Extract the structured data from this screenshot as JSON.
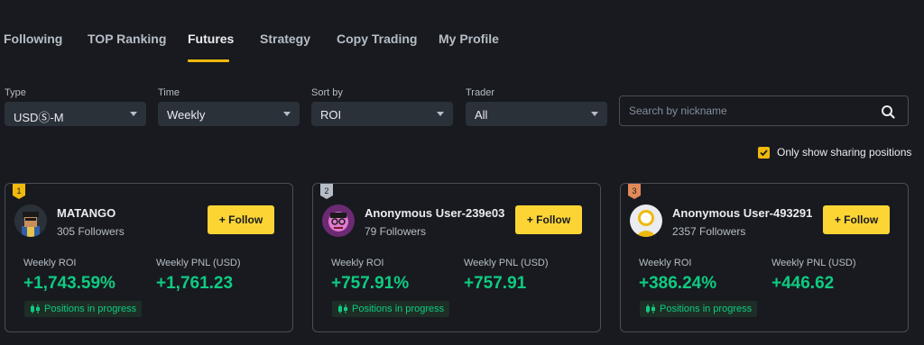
{
  "tabs": [
    {
      "label": "Following"
    },
    {
      "label": "TOP Ranking"
    },
    {
      "label": "Futures"
    },
    {
      "label": "Strategy"
    },
    {
      "label": "Copy Trading"
    },
    {
      "label": "My Profile"
    }
  ],
  "active_tab": "Futures",
  "filters": {
    "type": {
      "label": "Type",
      "value": "USDⓈ-M"
    },
    "time": {
      "label": "Time",
      "value": "Weekly"
    },
    "sort_by": {
      "label": "Sort by",
      "value": "ROI"
    },
    "trader": {
      "label": "Trader",
      "value": "All"
    }
  },
  "search": {
    "placeholder": "Search by nickname"
  },
  "only_sharing": {
    "label": "Only show sharing positions",
    "checked": true
  },
  "colors": {
    "accent": "#fcd535",
    "positive": "#0ecb81",
    "gold": "#f0b90b",
    "silver": "#b7bdc6",
    "bronze": "#e0895a"
  },
  "cards": [
    {
      "rank": "1",
      "name": "MATANGO",
      "followers": "305 Followers",
      "follow_label": "+ Follow",
      "roi_label": "Weekly ROI",
      "roi_value": "+1,743.59%",
      "pnl_label": "Weekly PNL (USD)",
      "pnl_value": "+1,761.23",
      "status": "Positions in progress"
    },
    {
      "rank": "2",
      "name": "Anonymous User-239e03",
      "followers": "79 Followers",
      "follow_label": "+ Follow",
      "roi_label": "Weekly ROI",
      "roi_value": "+757.91%",
      "pnl_label": "Weekly PNL (USD)",
      "pnl_value": "+757.91",
      "status": "Positions in progress"
    },
    {
      "rank": "3",
      "name": "Anonymous User-493291",
      "followers": "2357 Followers",
      "follow_label": "+ Follow",
      "roi_label": "Weekly ROI",
      "roi_value": "+386.24%",
      "pnl_label": "Weekly PNL (USD)",
      "pnl_value": "+446.62",
      "status": "Positions in progress"
    }
  ]
}
